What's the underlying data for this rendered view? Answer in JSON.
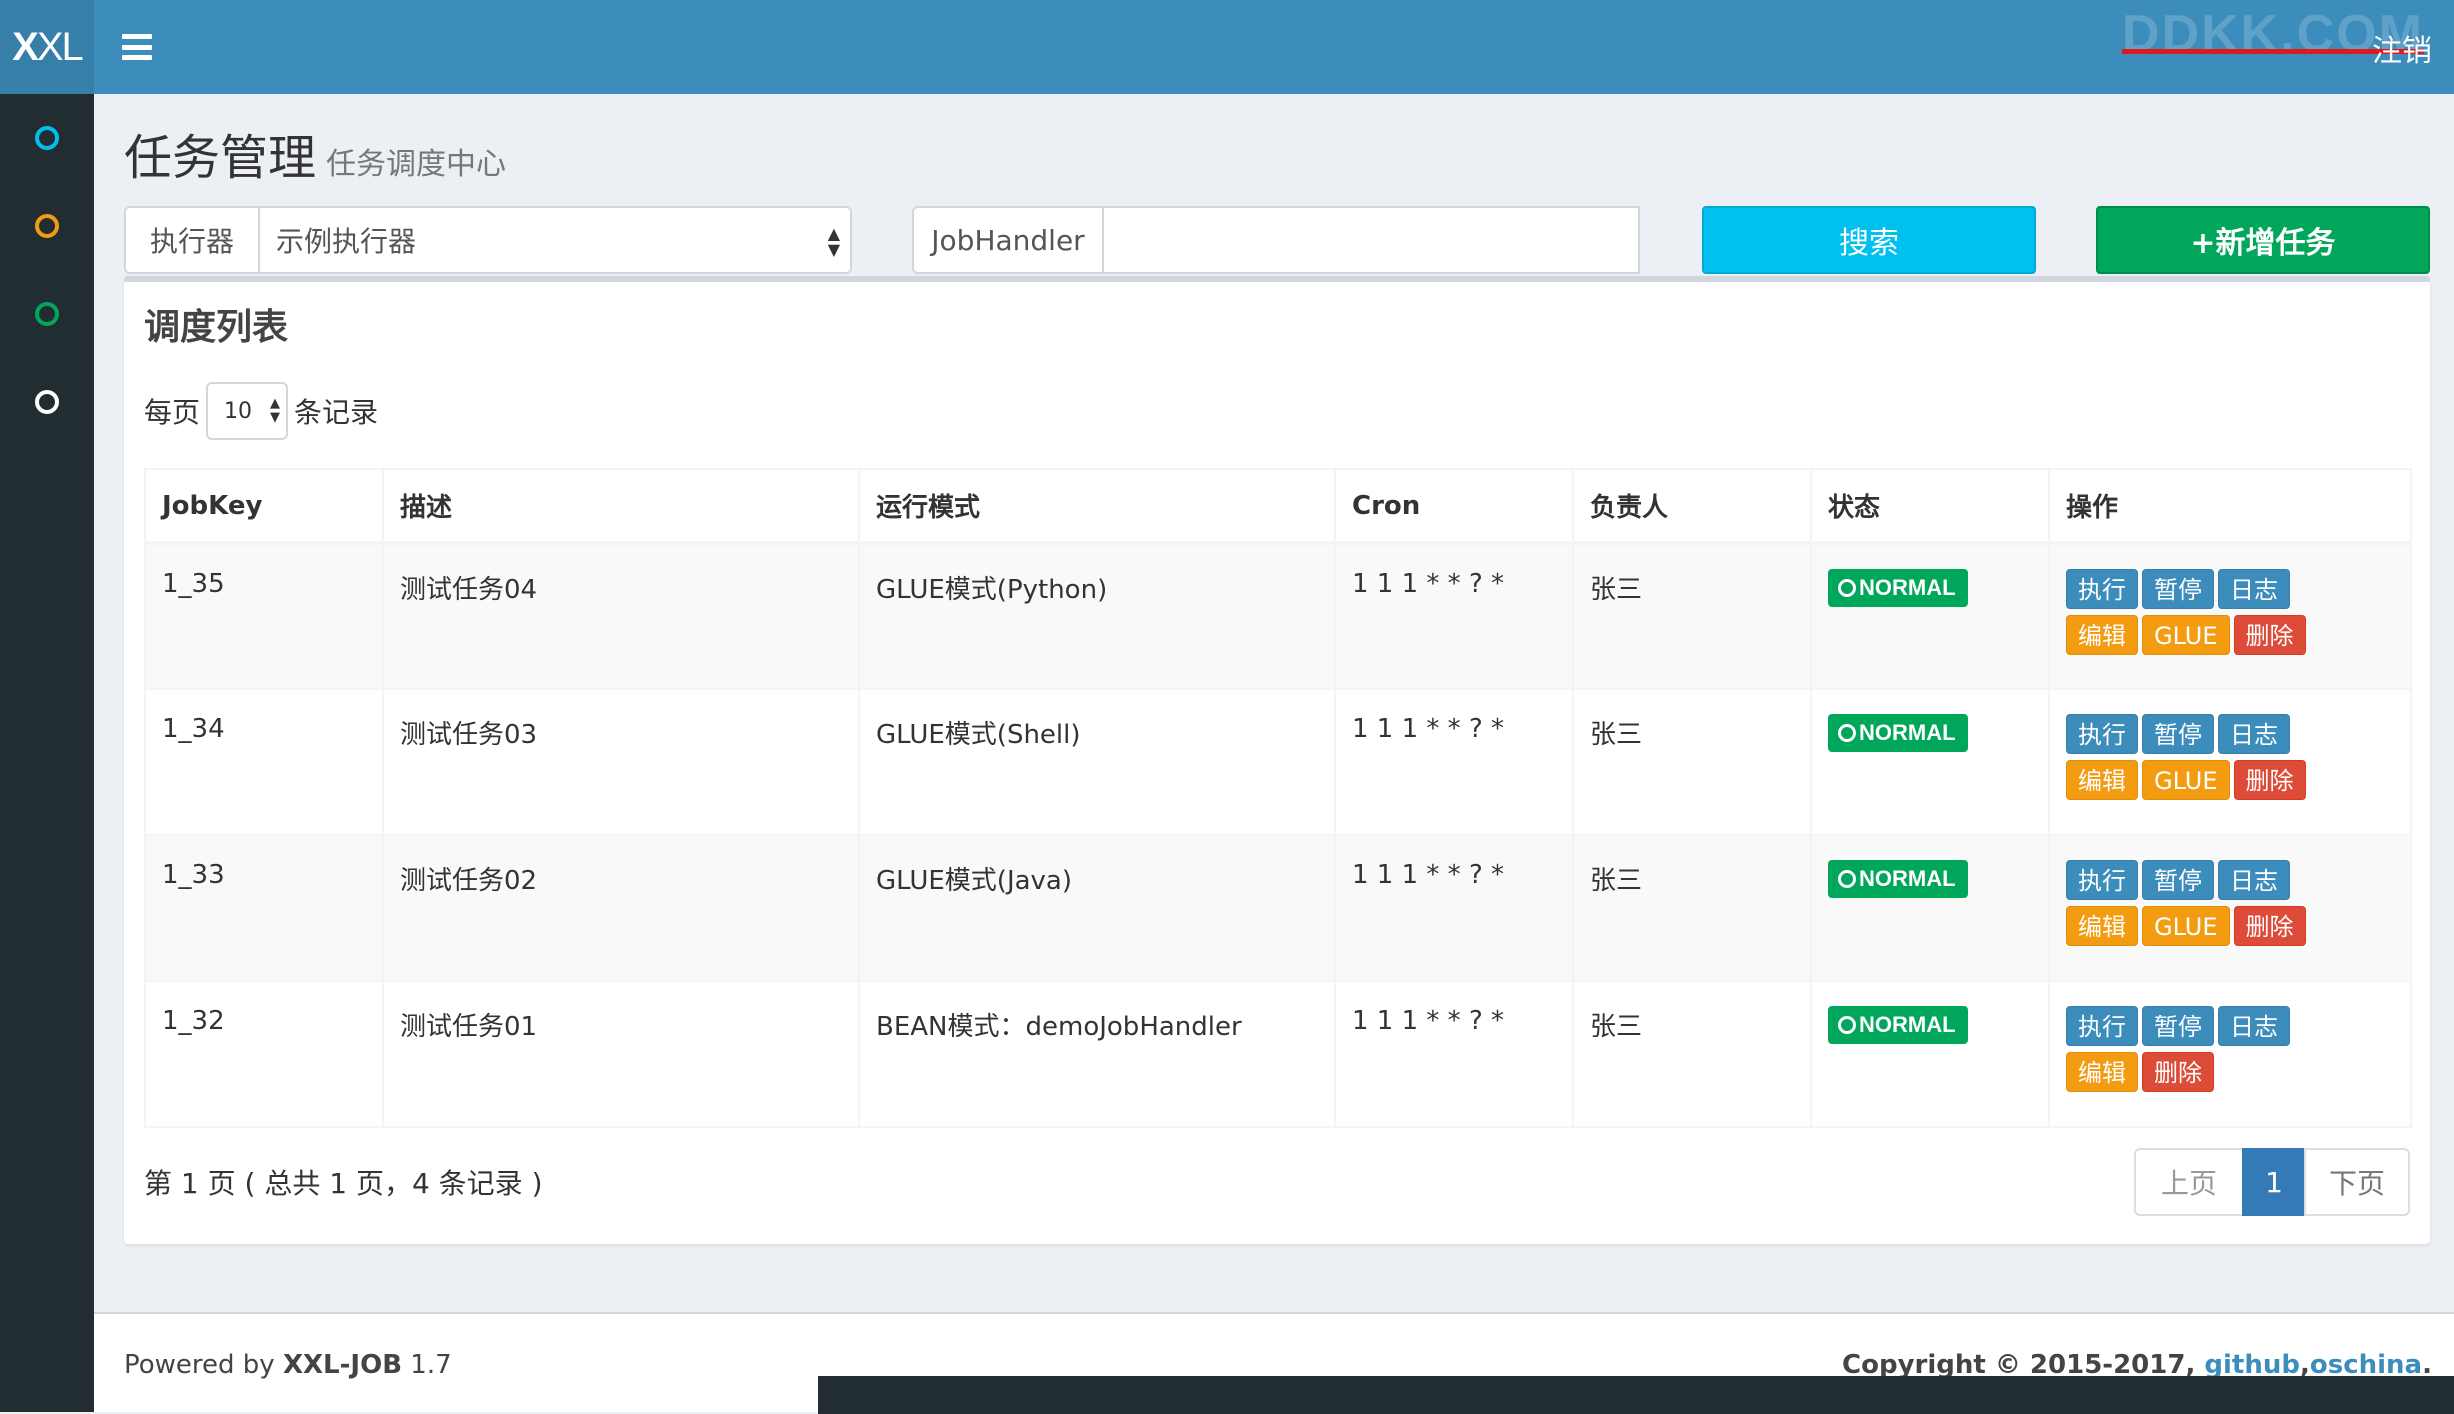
{
  "header": {
    "logo_bold": "X",
    "logo_rest": "XL",
    "watermark": "DDKK.COM",
    "logout": "注销"
  },
  "sidebar": {
    "items": [
      {
        "icon": "circle-icon",
        "color": "#00c0ef"
      },
      {
        "icon": "circle-icon",
        "color": "#f39c12"
      },
      {
        "icon": "circle-icon",
        "color": "#00a65a"
      },
      {
        "icon": "circle-icon",
        "color": "#ffffff"
      }
    ]
  },
  "page": {
    "title": "任务管理",
    "subtitle": "任务调度中心"
  },
  "filters": {
    "executor_label": "执行器",
    "executor_value": "示例执行器",
    "jobhandler_label": "JobHandler",
    "jobhandler_value": "",
    "search_button": "搜索",
    "add_button": "+新增任务"
  },
  "list": {
    "title": "调度列表",
    "per_page_prefix": "每页",
    "per_page_value": "10",
    "per_page_suffix": "条记录",
    "columns": [
      "JobKey",
      "描述",
      "运行模式",
      "Cron",
      "负责人",
      "状态",
      "操作"
    ],
    "rows": [
      {
        "key": "1_35",
        "desc": "测试任务04",
        "mode": "GLUE模式(Python)",
        "cron": "1 1 1 * * ? *",
        "owner": "张三",
        "status": "NORMAL",
        "ops": [
          "执行",
          "暂停",
          "日志",
          "编辑",
          "GLUE",
          "删除"
        ]
      },
      {
        "key": "1_34",
        "desc": "测试任务03",
        "mode": "GLUE模式(Shell)",
        "cron": "1 1 1 * * ? *",
        "owner": "张三",
        "status": "NORMAL",
        "ops": [
          "执行",
          "暂停",
          "日志",
          "编辑",
          "GLUE",
          "删除"
        ]
      },
      {
        "key": "1_33",
        "desc": "测试任务02",
        "mode": "GLUE模式(Java)",
        "cron": "1 1 1 * * ? *",
        "owner": "张三",
        "status": "NORMAL",
        "ops": [
          "执行",
          "暂停",
          "日志",
          "编辑",
          "GLUE",
          "删除"
        ]
      },
      {
        "key": "1_32",
        "desc": "测试任务01",
        "mode": "BEAN模式：demoJobHandler",
        "cron": "1 1 1 * * ? *",
        "owner": "张三",
        "status": "NORMAL",
        "ops": [
          "执行",
          "暂停",
          "日志",
          "编辑",
          "删除"
        ]
      }
    ],
    "summary": "第 1 页 ( 总共 1 页，4 条记录 )",
    "pager": {
      "prev": "上页",
      "current": "1",
      "next": "下页"
    }
  },
  "footer": {
    "powered_prefix": "Powered by ",
    "powered_brand": "XXL-JOB",
    "powered_version": " 1.7",
    "copyright": "Copyright © 2015-2017",
    "link_github": "github",
    "link_oschina": "oschina"
  },
  "colors": {
    "header": "#3c8dbc",
    "logo": "#367fa9",
    "sidebar": "#222d32",
    "search": "#00c0ef",
    "add": "#00a65a",
    "status": "#00a65a",
    "op_blue": "#3c8dbc",
    "op_orange": "#f39c12",
    "op_red": "#dd4b39"
  }
}
